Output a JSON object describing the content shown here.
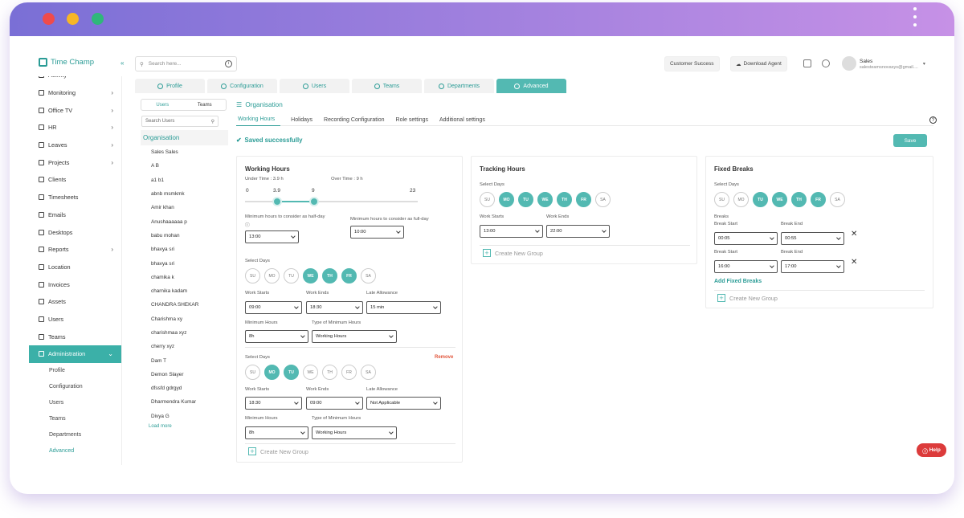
{
  "window": {
    "dot_colors": [
      "#f04b4b",
      "#f7b626",
      "#2fb77a"
    ]
  },
  "app": {
    "name": "Time Champ"
  },
  "search": {
    "placeholder": "Search here..."
  },
  "topbar": {
    "customer_success": "Customer Success",
    "download_agent": "Download Agent"
  },
  "user": {
    "name": "Sales",
    "email": "salesteamsnovasys@gmail...."
  },
  "sidebar": {
    "items": [
      {
        "label": "Activity",
        "icon": "activity-icon"
      },
      {
        "label": "Monitoring",
        "icon": "monitor-icon",
        "chevron": true
      },
      {
        "label": "Office TV",
        "icon": "tv-icon",
        "chevron": true
      },
      {
        "label": "HR",
        "icon": "hr-icon",
        "chevron": true
      },
      {
        "label": "Leaves",
        "icon": "calendar-icon",
        "chevron": true
      },
      {
        "label": "Projects",
        "icon": "briefcase-icon",
        "chevron": true
      },
      {
        "label": "Clients",
        "icon": "clients-icon"
      },
      {
        "label": "Timesheets",
        "icon": "clock-icon"
      },
      {
        "label": "Emails",
        "icon": "mail-icon"
      },
      {
        "label": "Desktops",
        "icon": "desktop-icon"
      },
      {
        "label": "Reports",
        "icon": "reports-icon",
        "chevron": true
      },
      {
        "label": "Location",
        "icon": "location-icon"
      },
      {
        "label": "Invoices",
        "icon": "invoice-icon"
      },
      {
        "label": "Assets",
        "icon": "assets-icon"
      },
      {
        "label": "Users",
        "icon": "users-icon"
      },
      {
        "label": "Teams",
        "icon": "teams-icon"
      },
      {
        "label": "Administration",
        "icon": "admin-icon",
        "chevron": true,
        "active": true
      }
    ],
    "sub_items": [
      "Profile",
      "Configuration",
      "Users",
      "Teams",
      "Departments",
      "Advanced"
    ]
  },
  "module_tabs": [
    "Profile",
    "Configuration",
    "Users",
    "Teams",
    "Departments",
    "Advanced"
  ],
  "users_panel": {
    "tabs": [
      "Users",
      "Teams"
    ],
    "search_placeholder": "Search Users",
    "org": "Organisation",
    "users": [
      "Sales Sales",
      "A B",
      "a1 b1",
      "abnb msmkmk",
      "Amir khan",
      "Anushaaaaaa p",
      "babu mohan",
      "bhavya sri",
      "bhavya sri",
      "chamika k",
      "charnika kadam",
      "CHANDRA SHEKAR",
      "Charishma xy",
      "charishmaa xyz",
      "cherry xyz",
      "Dam T",
      "Demon Slayer",
      "dfssfd gdrgyd",
      "Dharmendra Kumar",
      "Divya G"
    ],
    "load_more": "Load more"
  },
  "main": {
    "title": "Organisation",
    "tabs": [
      "Working Hours",
      "Holidays",
      "Recording Configuration",
      "Role settings",
      "Additional settings"
    ],
    "saved": "Saved successfully",
    "save": "Save"
  },
  "working_hours": {
    "title": "Working Hours",
    "under_time": "Under Time : 3.9 h",
    "over_time": "Over Time : 9 h",
    "scale": [
      "0",
      "3.9",
      "9",
      "23"
    ],
    "half_day_label": "Minimum hours to consider as half-day",
    "full_day_label": "Minimum hours to consider as full-day",
    "half_day": "13:00",
    "full_day": "10:00",
    "select_days": "Select Days",
    "work_starts": "Work Starts",
    "work_ends": "Work Ends",
    "late_allowance": "Late Allowance",
    "minimum_hours": "Minimum Hours",
    "type_min_hours": "Type of Minimum Hours",
    "remove": "Remove",
    "create_group": "Create New Group",
    "group1": {
      "start": "09:00",
      "end": "18:30",
      "late": "15 min",
      "min": "8h",
      "type": "Working Hours"
    },
    "group2": {
      "start": "18:30",
      "end": "09:00",
      "late": "Not Applicable",
      "min": "8h",
      "type": "Working Hours"
    }
  },
  "days": [
    "SU",
    "MO",
    "TU",
    "WE",
    "TH",
    "FR",
    "SA"
  ],
  "tracking_hours": {
    "title": "Tracking Hours",
    "select_days": "Select Days",
    "work_starts": "Work Starts",
    "work_ends": "Work Ends",
    "start": "13:00",
    "end": "22:00",
    "create_group": "Create New Group"
  },
  "fixed_breaks": {
    "title": "Fixed Breaks",
    "select_days": "Select Days",
    "breaks": "Breaks",
    "break_start": "Break Start",
    "break_end": "Break End",
    "b1_start": "00:05",
    "b1_end": "00:55",
    "b2_start": "16:00",
    "b2_end": "17:00",
    "add": "Add Fixed Breaks",
    "create_group": "Create New Group"
  },
  "help": "Help",
  "colors": {
    "accent": "#53b9b2",
    "danger": "#dc3b3b"
  }
}
